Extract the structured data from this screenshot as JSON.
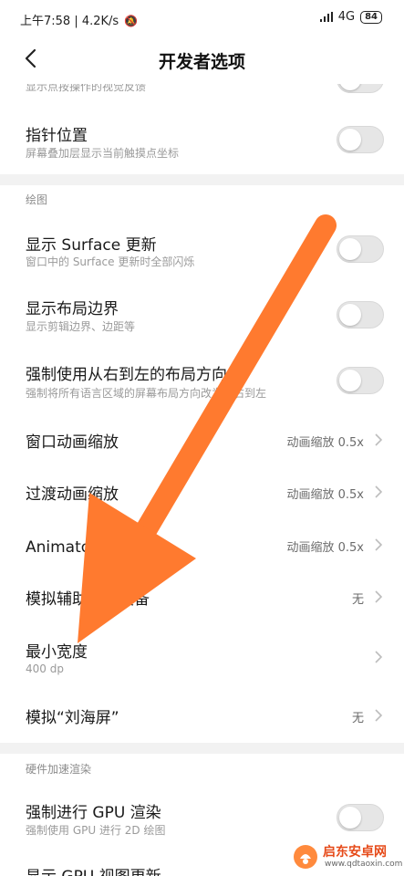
{
  "status_bar": {
    "time_speed": "上午7:58 | 4.2K/s",
    "network": "4G",
    "battery": "84"
  },
  "header": {
    "title": "开发者选项"
  },
  "top_partial": {
    "subtitle": "显示点按操作的视觉反馈"
  },
  "rows": {
    "pointer_location": {
      "title": "指针位置",
      "subtitle": "屏幕叠加层显示当前触摸点坐标"
    },
    "surface_updates": {
      "title": "显示 Surface 更新",
      "subtitle": "窗口中的 Surface 更新时全部闪烁"
    },
    "layout_bounds": {
      "title": "显示布局边界",
      "subtitle": "显示剪辑边界、边距等"
    },
    "force_rtl": {
      "title": "强制使用从右到左的布局方向",
      "subtitle": "强制将所有语言区域的屏幕布局方向改为从右到左"
    },
    "window_anim": {
      "title": "窗口动画缩放",
      "value": "动画缩放 0.5x"
    },
    "transition_anim": {
      "title": "过渡动画缩放",
      "value": "动画缩放 0.5x"
    },
    "animator_duration": {
      "title": "Animator 时长缩放",
      "value": "动画缩放 0.5x"
    },
    "secondary_display": {
      "title": "模拟辅助显示设备",
      "value": "无"
    },
    "smallest_width": {
      "title": "最小宽度",
      "subtitle": "400 dp"
    },
    "notch": {
      "title": "模拟“刘海屏”",
      "value": "无"
    },
    "force_gpu": {
      "title": "强制进行 GPU 渲染",
      "subtitle": "强制使用 GPU 进行 2D 绘图"
    },
    "gpu_view_updates": {
      "title": "显示 GPU 视图更新"
    }
  },
  "sections": {
    "drawing": "绘图",
    "hw_accel": "硬件加速渲染"
  },
  "watermark": {
    "name": "启东安卓网",
    "url": "www.qdtaoxin.com"
  },
  "colors": {
    "arrow": "#FF7A2F",
    "toggle_off": "#E6E6E6",
    "separator": "#F2F2F2"
  }
}
